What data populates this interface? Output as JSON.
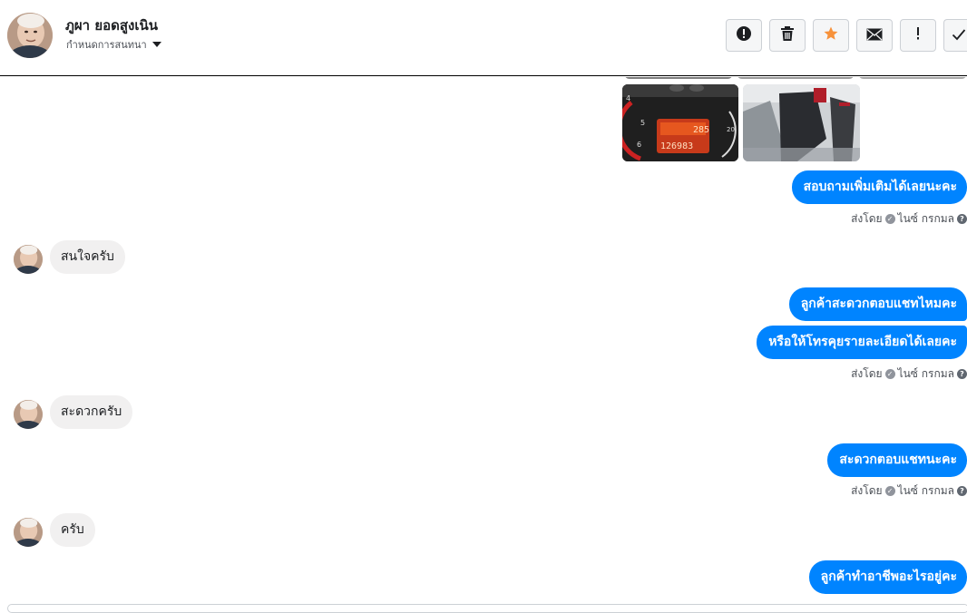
{
  "header": {
    "contact_name": "ภูผา ยอดสูงเนิน",
    "assign_label": "กำหนดการสนทนา",
    "actions": [
      {
        "icon": "alert-circle-icon",
        "name": "spam-button"
      },
      {
        "icon": "trash-icon",
        "name": "delete-button"
      },
      {
        "icon": "star-icon",
        "name": "star-button"
      },
      {
        "icon": "envelope-icon",
        "name": "mark-unread-button"
      },
      {
        "icon": "exclamation-icon",
        "name": "follow-up-button"
      },
      {
        "icon": "check-icon",
        "name": "done-button"
      }
    ]
  },
  "colors": {
    "outgoing_bubble": "#0084ff",
    "incoming_bubble": "#f1f0f0",
    "star": "#f7923b"
  },
  "photos": {
    "dash_numbers": {
      "speed": "285",
      "odometer": "126983",
      "gauge_left_top": "4",
      "gauge_left_mid": "5",
      "gauge_left_bot": "6",
      "gauge_right": "20"
    }
  },
  "messages": {
    "m1": "สอบถามเพิ่มเติมได้เลยนะคะ",
    "m1_sent_by": "ส่งโดย",
    "m1_sender": "ไนซ์ กรกมล",
    "m2": "สนใจครับ",
    "m3": "ลูกค้าสะดวกตอบแชทไหมคะ",
    "m4": "หรือให้โทรคุยรายละเอียดได้เลยคะ",
    "m4_sent_by": "ส่งโดย",
    "m4_sender": "ไนซ์ กรกมล",
    "m5": "สะดวกครับ",
    "m6": "สะดวกตอบแชทนะคะ",
    "m6_sent_by": "ส่งโดย",
    "m6_sender": "ไนซ์ กรกมล",
    "m7": "ครับ",
    "m8": "ลูกค้าทำอาชีพอะไรอยู่คะ"
  }
}
